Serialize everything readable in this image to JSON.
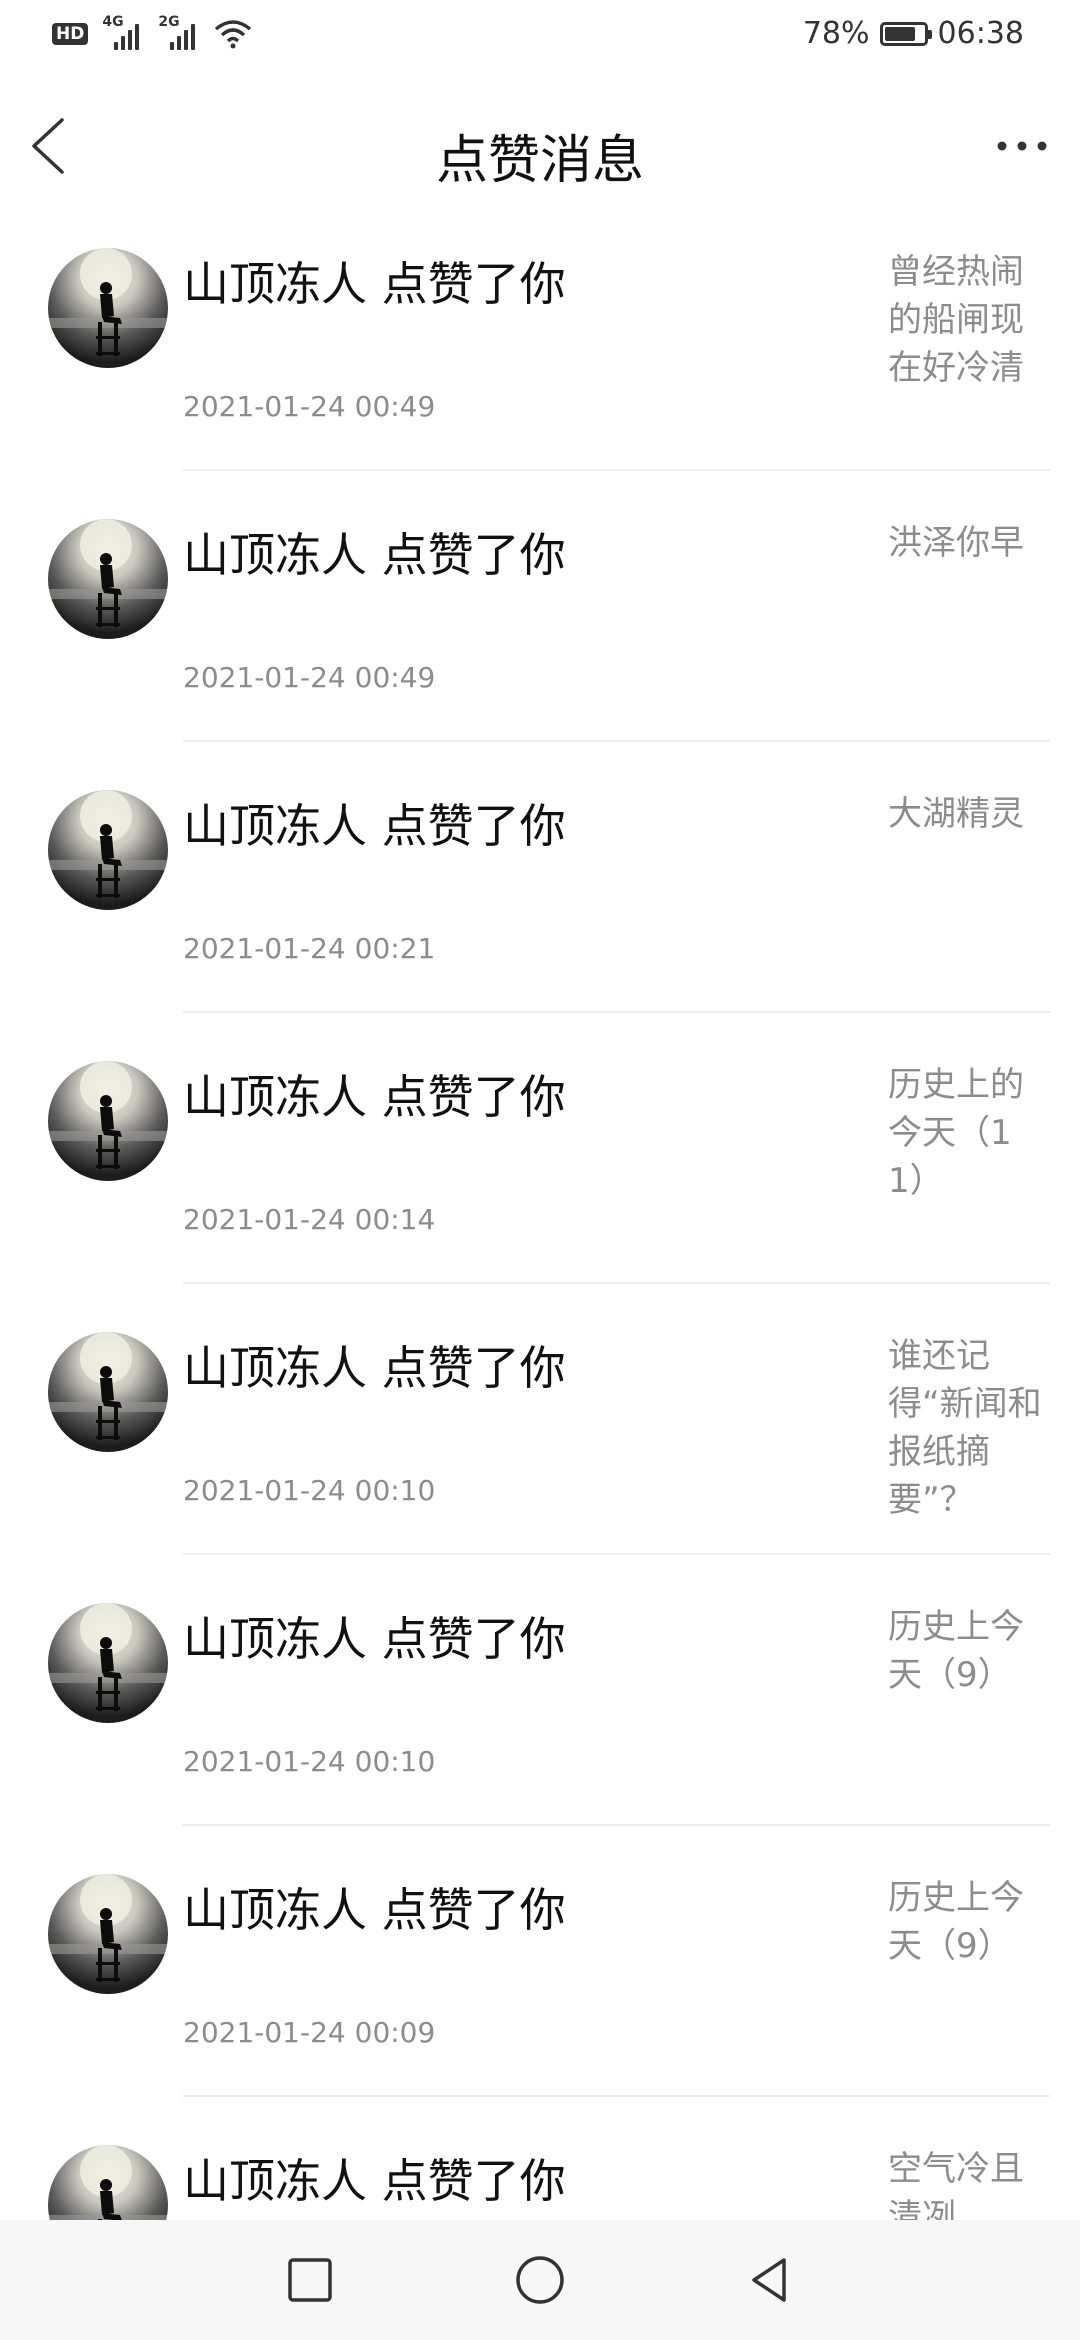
{
  "status_bar": {
    "hd_label": "HD",
    "net1": "4G",
    "net2": "2G",
    "battery_percent": "78%",
    "battery_level": 0.78,
    "time": "06:38"
  },
  "header": {
    "title": "点赞消息",
    "back_icon": "chevron-left",
    "more_icon": "ellipsis"
  },
  "items": [
    {
      "name": "山顶冻人 点赞了你",
      "time": "2021-01-24 00:49",
      "side": "曾经热闹的船闸现在好冷清"
    },
    {
      "name": "山顶冻人 点赞了你",
      "time": "2021-01-24 00:49",
      "side": "洪泽你早"
    },
    {
      "name": "山顶冻人 点赞了你",
      "time": "2021-01-24 00:21",
      "side": "大湖精灵"
    },
    {
      "name": "山顶冻人 点赞了你",
      "time": "2021-01-24 00:14",
      "side": "历史上的今天（11）"
    },
    {
      "name": "山顶冻人 点赞了你",
      "time": "2021-01-24 00:10",
      "side": "谁还记得“新闻和报纸摘要”？"
    },
    {
      "name": "山顶冻人 点赞了你",
      "time": "2021-01-24 00:10",
      "side": "历史上今天（9）"
    },
    {
      "name": "山顶冻人 点赞了你",
      "time": "2021-01-24 00:09",
      "side": "历史上今天（9）"
    },
    {
      "name": "山顶冻人 点赞了你",
      "time": "",
      "side": "空气冷且清冽"
    }
  ],
  "navbar": {
    "recent_icon": "square",
    "home_icon": "circle",
    "back_icon": "triangle-left"
  }
}
